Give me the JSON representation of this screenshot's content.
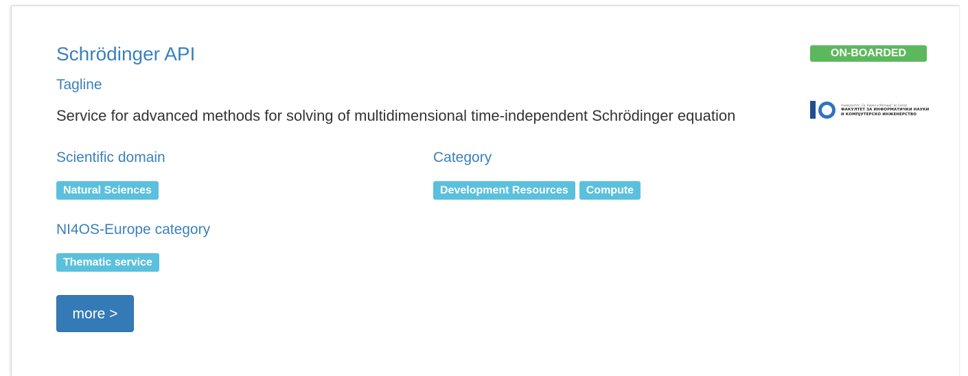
{
  "service": {
    "title": "Schrödinger API",
    "status": "ON-BOARDED",
    "tagline_label": "Tagline",
    "tagline_text": "Service for advanced methods for solving of multidimensional time-independent Schrödinger equation",
    "logo": {
      "icon": "finki-logo",
      "line1": "Универзитет „Св. Кирил и Методиј“ во Скопје",
      "line2": "ФАКУЛТЕТ ЗА ИНФОРМАТИЧКИ НАУКИ",
      "line3": "И КОМПЈУТЕРСКО ИНЖЕНЕРСТВО"
    }
  },
  "sections": {
    "scientific_domain": {
      "label": "Scientific domain",
      "tags": [
        "Natural Sciences"
      ]
    },
    "category": {
      "label": "Category",
      "tags": [
        "Development Resources",
        "Compute"
      ]
    },
    "ni4os_category": {
      "label": "NI4OS-Europe category",
      "tags": [
        "Thematic service"
      ]
    }
  },
  "actions": {
    "more_label": "more >"
  },
  "colors": {
    "link_blue": "#3a80bd",
    "tag_info": "#5bc0de",
    "status_success": "#5cb85c",
    "button_primary": "#337ab7"
  }
}
